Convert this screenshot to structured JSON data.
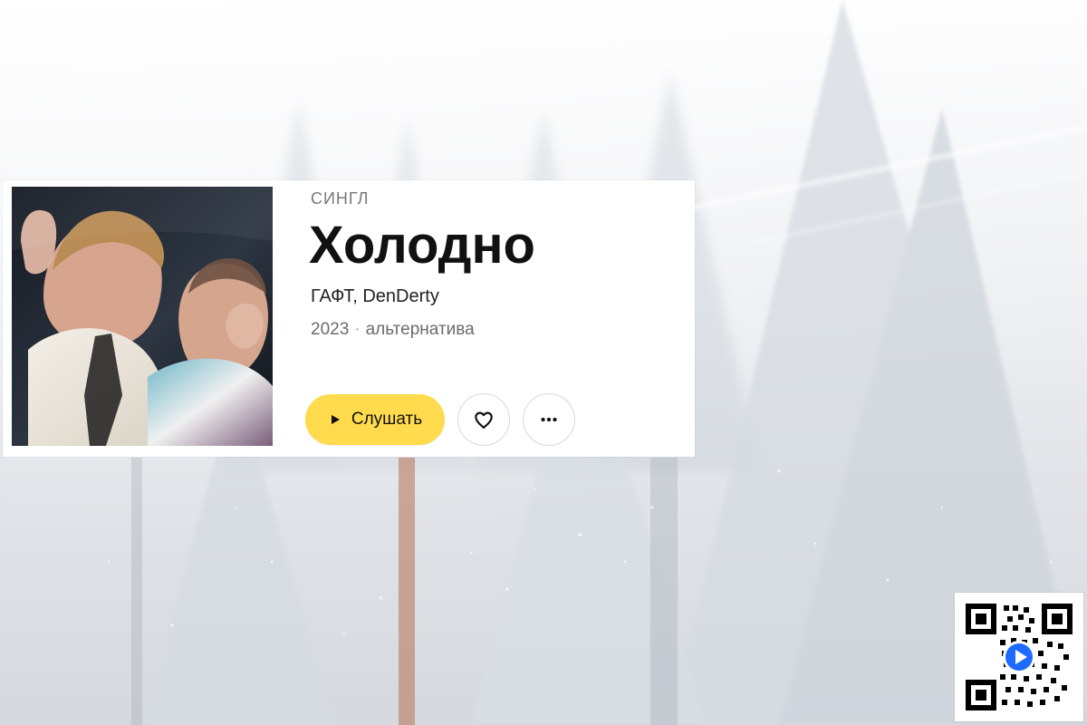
{
  "album": {
    "kind": "СИНГЛ",
    "title": "Холодно",
    "artists": "ГАФТ, DenDerty",
    "year": "2023",
    "genre": "альтернатива"
  },
  "actions": {
    "play_label": "Слушать"
  },
  "icons": {
    "play": "play-icon",
    "like": "heart-icon",
    "more": "more-icon",
    "qr": "qr-code-icon"
  },
  "colors": {
    "accent": "#ffdb4d",
    "text": "#111111",
    "muted": "#6b6b6b"
  }
}
